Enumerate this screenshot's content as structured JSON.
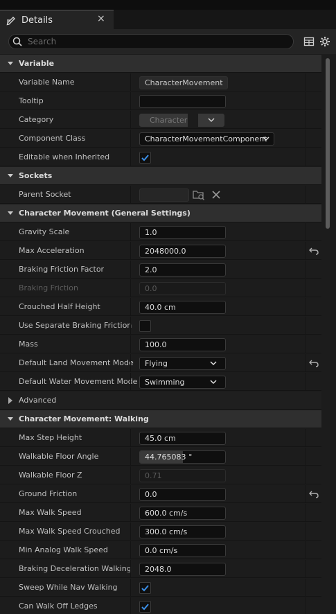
{
  "tab": {
    "title": "Details",
    "close": "×"
  },
  "search": {
    "placeholder": "Search"
  },
  "variable": {
    "header": "Variable",
    "name_label": "Variable Name",
    "name_value": "CharacterMovement",
    "tooltip_label": "Tooltip",
    "tooltip_value": "",
    "category_label": "Category",
    "category_value": "Character",
    "component_class_label": "Component Class",
    "component_class_value": "CharacterMovementComponent",
    "editable_label": "Editable when Inherited",
    "editable_checked": true
  },
  "sockets": {
    "header": "Sockets",
    "parent_socket_label": "Parent Socket",
    "parent_socket_value": ""
  },
  "general": {
    "header": "Character Movement (General Settings)",
    "gravity_scale_label": "Gravity Scale",
    "gravity_scale_value": "1.0",
    "max_accel_label": "Max Acceleration",
    "max_accel_value": "2048000.0",
    "braking_factor_label": "Braking Friction Factor",
    "braking_factor_value": "2.0",
    "braking_friction_label": "Braking Friction",
    "braking_friction_value": "0.0",
    "crouched_label": "Crouched Half Height",
    "crouched_value": "40.0 cm",
    "use_sep_label": "Use Separate Braking Friction",
    "use_sep_checked": false,
    "mass_label": "Mass",
    "mass_value": "100.0",
    "land_mode_label": "Default Land Movement Mode",
    "land_mode_value": "Flying",
    "water_mode_label": "Default Water Movement Mode",
    "water_mode_value": "Swimming",
    "advanced_label": "Advanced"
  },
  "walking": {
    "header": "Character Movement: Walking",
    "max_step_label": "Max Step Height",
    "max_step_value": "45.0 cm",
    "floor_angle_label": "Walkable Floor Angle",
    "floor_angle_value": "44.765083 °",
    "floor_angle_fraction": 0.5,
    "floor_z_label": "Walkable Floor Z",
    "floor_z_value": "0.71",
    "ground_friction_label": "Ground Friction",
    "ground_friction_value": "0.0",
    "max_walk_label": "Max Walk Speed",
    "max_walk_value": "600.0 cm/s",
    "max_walk_crouched_label": "Max Walk Speed Crouched",
    "max_walk_crouched_value": "300.0 cm/s",
    "min_analog_label": "Min Analog Walk Speed",
    "min_analog_value": "0.0 cm/s",
    "braking_decel_label": "Braking Deceleration Walking",
    "braking_decel_value": "2048.0",
    "sweep_label": "Sweep While Nav Walking",
    "sweep_checked": true,
    "walk_off_label": "Can Walk Off Ledges",
    "walk_off_checked": true
  },
  "colors": {
    "accent": "#2a7fd9",
    "check": "#3b8fe8"
  }
}
